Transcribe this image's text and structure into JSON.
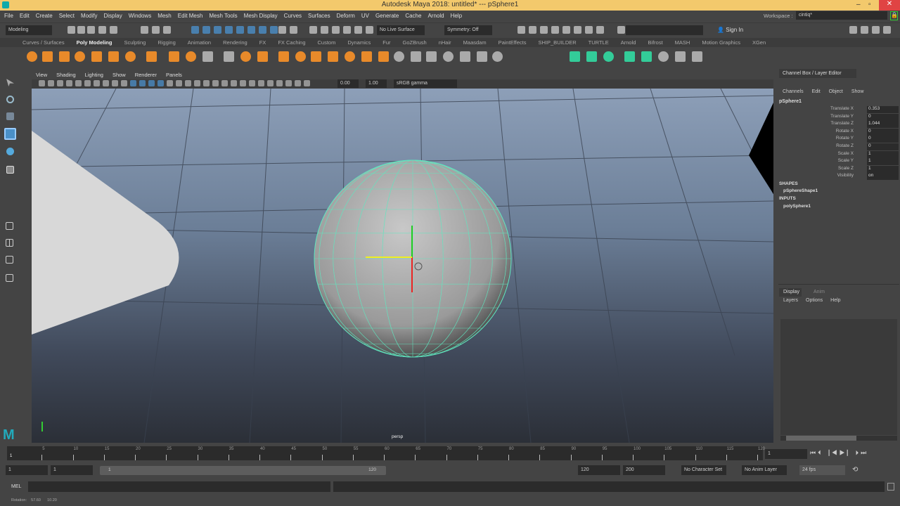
{
  "window": {
    "title": "Autodesk Maya 2018: untitled*   ---   pSphere1"
  },
  "menus": [
    "File",
    "Edit",
    "Create",
    "Select",
    "Modify",
    "Display",
    "Windows",
    "Mesh",
    "Edit Mesh",
    "Mesh Tools",
    "Mesh Display",
    "Curves",
    "Surfaces",
    "Deform",
    "UV",
    "Generate",
    "Cache",
    "Arnold",
    "Help"
  ],
  "workspace": {
    "label": "Workspace :",
    "value": "cintiq*"
  },
  "status": {
    "mode": "Modeling",
    "live_surface": "No Live Surface",
    "symmetry": "Symmetry: Off",
    "sign_in": "Sign In"
  },
  "shelf_tabs": [
    "Curves / Surfaces",
    "Poly Modeling",
    "Sculpting",
    "Rigging",
    "Animation",
    "Rendering",
    "FX",
    "FX Caching",
    "Custom",
    "Dynamics",
    "Fur",
    "GoZBrush",
    "nHair",
    "Maasdam",
    "PaintEffects",
    "SHIP_BUILDER",
    "TURTLE",
    "Arnold",
    "Bifrost",
    "MASH",
    "Motion Graphics",
    "XGen"
  ],
  "viewport": {
    "menus": [
      "View",
      "Shading",
      "Lighting",
      "Show",
      "Renderer",
      "Panels"
    ],
    "exposure": "0.00",
    "gamma": "1.00",
    "color_space": "sRGB gamma",
    "camera_label": "persp"
  },
  "channel_box": {
    "title": "Channel Box / Layer Editor",
    "menus": [
      "Channels",
      "Edit",
      "Object",
      "Show"
    ],
    "object": "pSphere1",
    "channels": [
      {
        "label": "Translate X",
        "value": "0.353"
      },
      {
        "label": "Translate Y",
        "value": "0"
      },
      {
        "label": "Translate Z",
        "value": "1.044"
      },
      {
        "label": "Rotate X",
        "value": "0"
      },
      {
        "label": "Rotate Y",
        "value": "0"
      },
      {
        "label": "Rotate Z",
        "value": "0"
      },
      {
        "label": "Scale X",
        "value": "1"
      },
      {
        "label": "Scale Y",
        "value": "1"
      },
      {
        "label": "Scale Z",
        "value": "1"
      },
      {
        "label": "Visibility",
        "value": "on"
      }
    ],
    "shapes_header": "SHAPES",
    "shape": "pSphereShape1",
    "inputs_header": "INPUTS",
    "input": "polySphere1"
  },
  "layer_editor": {
    "tabs": [
      "Display",
      "Anim"
    ],
    "menus": [
      "Layers",
      "Options",
      "Help"
    ]
  },
  "timeline": {
    "ticks": [
      "5",
      "10",
      "15",
      "20",
      "25",
      "30",
      "35",
      "40",
      "45",
      "50",
      "55",
      "60",
      "65",
      "70",
      "75",
      "80",
      "85",
      "90",
      "95",
      "100",
      "105",
      "110",
      "115",
      "120"
    ],
    "current_frame": "1",
    "current_field": "1"
  },
  "range": {
    "start": "1",
    "anim_start": "1",
    "range_start": "1",
    "range_end": "120",
    "end": "120",
    "anim_end": "200",
    "character_set": "No Character Set",
    "anim_layer": "No Anim Layer",
    "fps": "24 fps"
  },
  "mel": {
    "label": "MEL"
  },
  "help_line": {
    "label": "Rotation:",
    "v1": "57.60",
    "v2": "10.20"
  }
}
